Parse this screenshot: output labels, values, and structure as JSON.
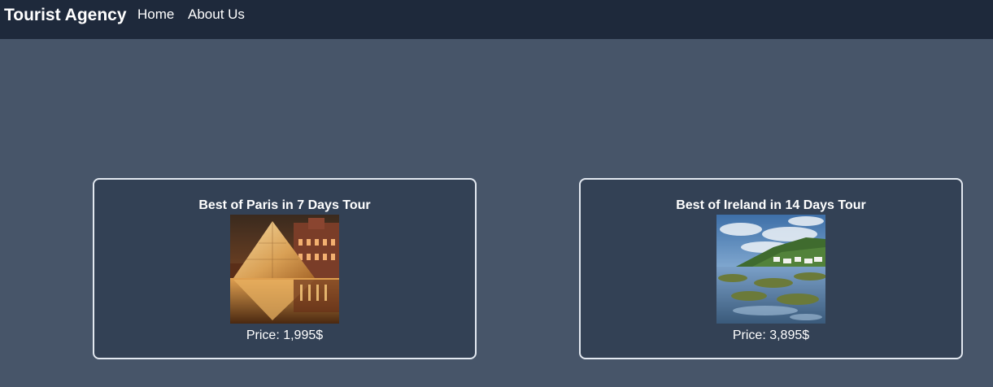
{
  "navbar": {
    "brand": "Tourist Agency",
    "links": [
      {
        "label": "Home"
      },
      {
        "label": "About Us"
      }
    ]
  },
  "tours": [
    {
      "title": "Best of Paris in 7 Days Tour",
      "price": "Price: 1,995$",
      "image": "louvre-pyramid-photo"
    },
    {
      "title": "Best of Ireland in 14 Days Tour",
      "price": "Price: 3,895$",
      "image": "ireland-coast-photo"
    }
  ],
  "colors": {
    "page_bg": "#475569",
    "navbar_bg": "#1e293b",
    "card_bg": "#334155",
    "card_border": "#e2e8f0",
    "text": "#ffffff"
  }
}
